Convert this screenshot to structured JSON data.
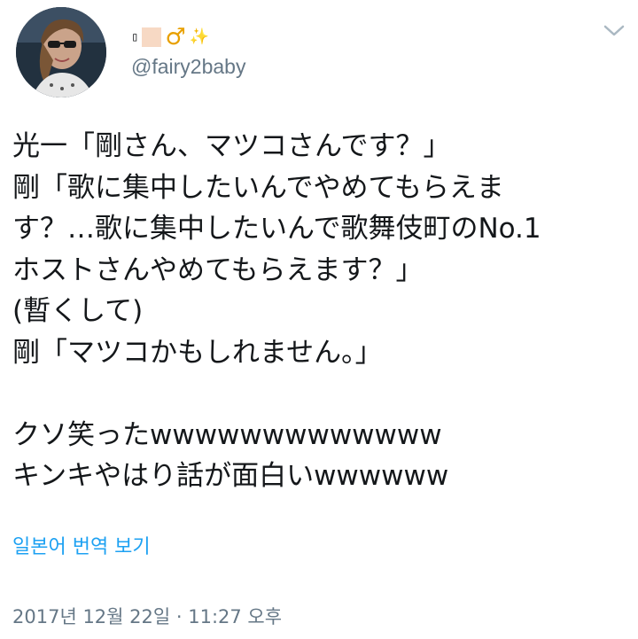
{
  "user": {
    "display_name_glyph": "▯",
    "display_name_icons": [
      "skin-tone-square",
      "male-sign-icon",
      "sparkle-icon"
    ],
    "male_sign": "♂",
    "sparkle": "✨",
    "handle": "@fairy2baby"
  },
  "tweet": {
    "lines": [
      "光一「剛さん、マツコさんです？」",
      "剛「歌に集中したいんでやめてもらえま",
      "す？…歌に集中したいんで歌舞伎町のNo.1",
      "ホストさんやめてもらえます？」",
      "(暫くして)",
      "剛「マツコかもしれません。」",
      "",
      "クソ笑ったwwwwwwwwwwwww",
      "キンキやはり話が面白いwwwwww"
    ]
  },
  "translate_label": "일본어 번역 보기",
  "timestamp": "2017년 12월 22일 · 11:27 오후",
  "colors": {
    "link": "#1da1f2",
    "muted": "#657786",
    "text": "#14171a"
  }
}
